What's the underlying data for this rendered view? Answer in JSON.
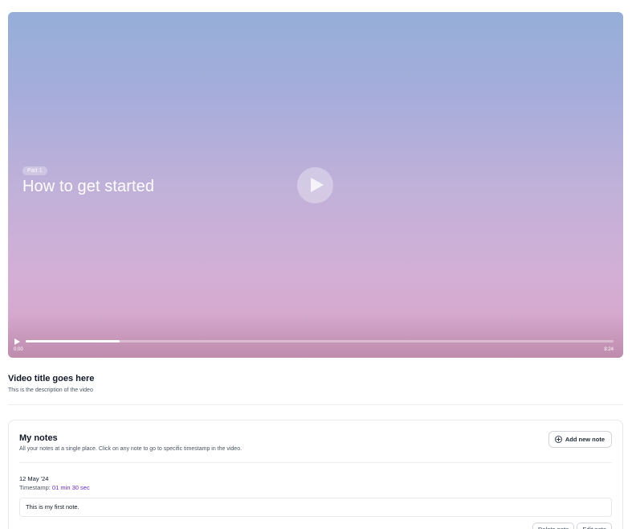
{
  "video": {
    "badge": "Part 1",
    "title": "How to get started",
    "progress_fraction": 0.16,
    "time_current": "0:00",
    "time_total": "8:24"
  },
  "meta": {
    "title": "Video title goes here",
    "description": "This is the description of the video"
  },
  "notes": {
    "title": "My notes",
    "subtitle": "All your notes at a single place. Click on any note to go to specific timestamp in the video.",
    "add_button_label": "Add new note",
    "items": [
      {
        "date": "12 May '24",
        "timestamp_label": "Timestamp:",
        "timestamp_value": "01 min 30 sec",
        "text": "This is my first note.",
        "delete_label": "Delete note",
        "edit_label": "Edit note"
      }
    ]
  },
  "colors": {
    "accent": "#6d28d9"
  },
  "icons": {
    "play_large": "play-icon",
    "play_small": "play-icon",
    "add": "plus-circle-icon"
  }
}
